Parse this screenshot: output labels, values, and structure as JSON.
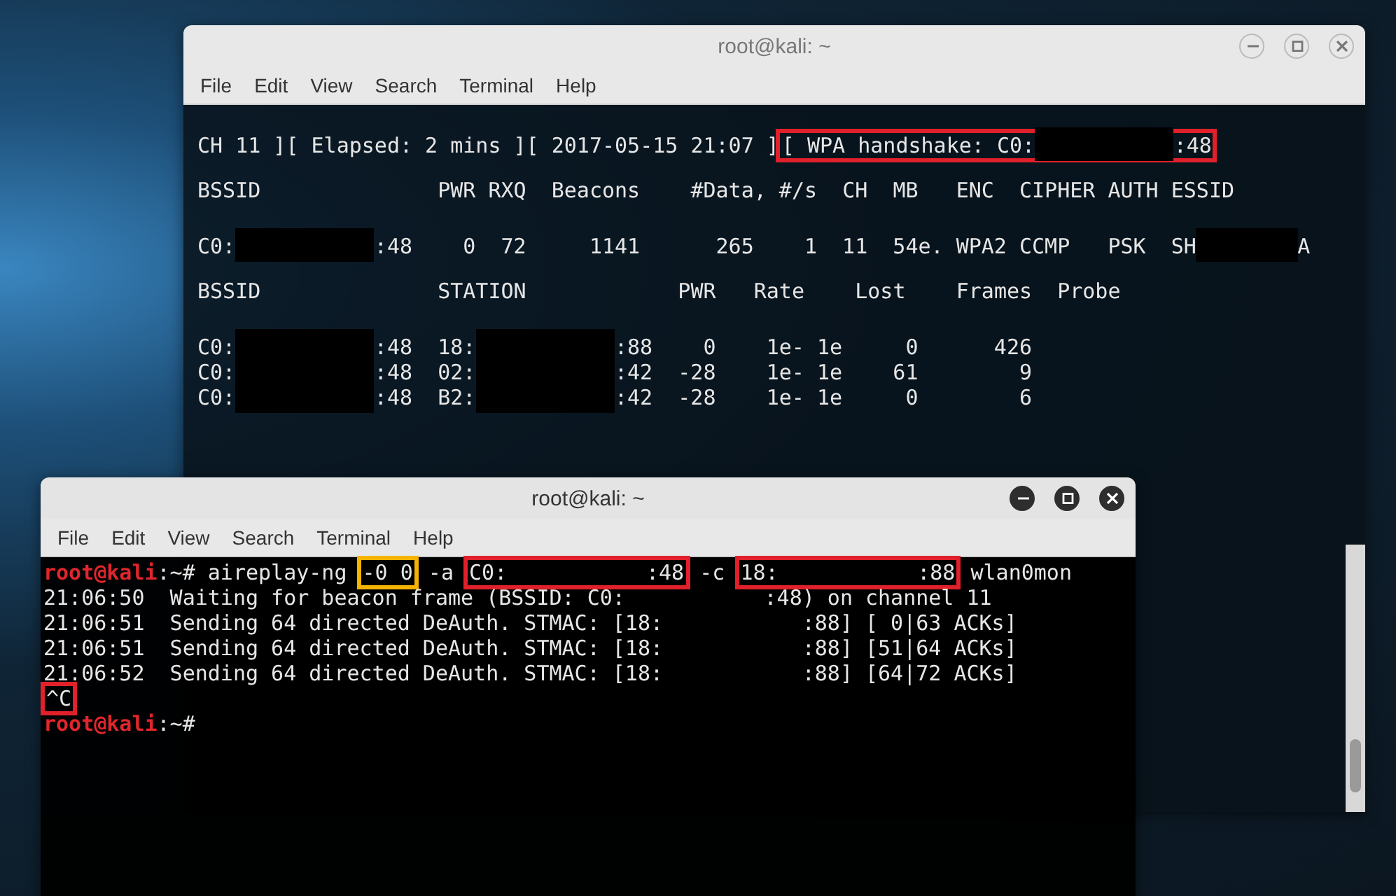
{
  "windows": [
    {
      "title": "root@kali: ~",
      "focused": false,
      "menu": [
        "File",
        "Edit",
        "View",
        "Search",
        "Terminal",
        "Help"
      ],
      "lines": [
        {
          "blank_after": true,
          "segments": [
            {
              "kind": "plain",
              "text": "CH 11 ][ Elapsed: 2 mins ][ 2017-05-15 21:07 ]"
            },
            {
              "kind": "boxed",
              "color": "#e0202a",
              "parts": [
                {
                  "kind": "plain",
                  "text": "[ WPA handshake: C0:"
                },
                {
                  "kind": "redacted"
                },
                {
                  "kind": "plain",
                  "text": ":48"
                }
              ]
            }
          ]
        },
        {
          "blank_after": true,
          "segments": [
            {
              "kind": "plain",
              "text": "BSSID              PWR RXQ  Beacons    #Data, #/s  CH  MB   ENC  CIPHER AUTH ESSID"
            }
          ]
        },
        {
          "blank_after": true,
          "segments": [
            {
              "kind": "plain",
              "text": "C0:"
            },
            {
              "kind": "redacted"
            },
            {
              "kind": "plain",
              "text": ":48    0  72     1141      265    1  11  54e. WPA2 CCMP   PSK  SH"
            },
            {
              "kind": "redacted_short"
            },
            {
              "kind": "plain",
              "text": "A"
            }
          ]
        },
        {
          "blank_after": true,
          "segments": [
            {
              "kind": "plain",
              "text": "BSSID              STATION            PWR   Rate    Lost    Frames  Probe"
            }
          ]
        },
        {
          "blank_after": false,
          "segments": [
            {
              "kind": "plain",
              "text": "C0:"
            },
            {
              "kind": "redacted"
            },
            {
              "kind": "plain",
              "text": ":48  18:"
            },
            {
              "kind": "redacted"
            },
            {
              "kind": "plain",
              "text": ":88    0    1e- 1e     0      426"
            }
          ]
        },
        {
          "blank_after": false,
          "segments": [
            {
              "kind": "plain",
              "text": "C0:"
            },
            {
              "kind": "redacted"
            },
            {
              "kind": "plain",
              "text": ":48  02:"
            },
            {
              "kind": "redacted"
            },
            {
              "kind": "plain",
              "text": ":42  -28    1e- 1e    61        9"
            }
          ]
        },
        {
          "blank_after": false,
          "segments": [
            {
              "kind": "plain",
              "text": "C0:"
            },
            {
              "kind": "redacted"
            },
            {
              "kind": "plain",
              "text": ":48  B2:"
            },
            {
              "kind": "redacted"
            },
            {
              "kind": "plain",
              "text": ":42  -28    1e- 1e     0        6"
            }
          ]
        }
      ]
    },
    {
      "title": "root@kali: ~",
      "focused": true,
      "menu": [
        "File",
        "Edit",
        "View",
        "Search",
        "Terminal",
        "Help"
      ],
      "lines": [
        {
          "blank_after": false,
          "segments": [
            {
              "kind": "prompt",
              "text": "root@kali"
            },
            {
              "kind": "plain",
              "text": ":~# aireplay-ng "
            },
            {
              "kind": "boxed",
              "color": "#f5b400",
              "text": "-0 0"
            },
            {
              "kind": "plain",
              "text": " -a "
            },
            {
              "kind": "boxed",
              "color": "#e0202a",
              "text": "C0:           :48"
            },
            {
              "kind": "plain",
              "text": " -c "
            },
            {
              "kind": "boxed",
              "color": "#e0202a",
              "text": "18:           :88"
            },
            {
              "kind": "plain",
              "text": " wlan0mon"
            }
          ]
        },
        {
          "blank_after": false,
          "segments": [
            {
              "kind": "plain",
              "text": "21:06:50  Waiting for beacon frame (BSSID: C0:           :48) on channel 11"
            }
          ]
        },
        {
          "blank_after": false,
          "segments": [
            {
              "kind": "plain",
              "text": "21:06:51  Sending 64 directed DeAuth. STMAC: [18:           :88] [ 0|63 ACKs]"
            }
          ]
        },
        {
          "blank_after": false,
          "segments": [
            {
              "kind": "plain",
              "text": "21:06:51  Sending 64 directed DeAuth. STMAC: [18:           :88] [51|64 ACKs]"
            }
          ]
        },
        {
          "blank_after": false,
          "segments": [
            {
              "kind": "plain",
              "text": "21:06:52  Sending 64 directed DeAuth. STMAC: [18:           :88] [64|72 ACKs]"
            }
          ]
        },
        {
          "blank_after": false,
          "segments": [
            {
              "kind": "boxed",
              "color": "#e0202a",
              "text": "^C"
            }
          ]
        },
        {
          "blank_after": false,
          "segments": [
            {
              "kind": "prompt",
              "text": "root@kali"
            },
            {
              "kind": "plain",
              "text": ":~#"
            }
          ]
        }
      ]
    }
  ]
}
